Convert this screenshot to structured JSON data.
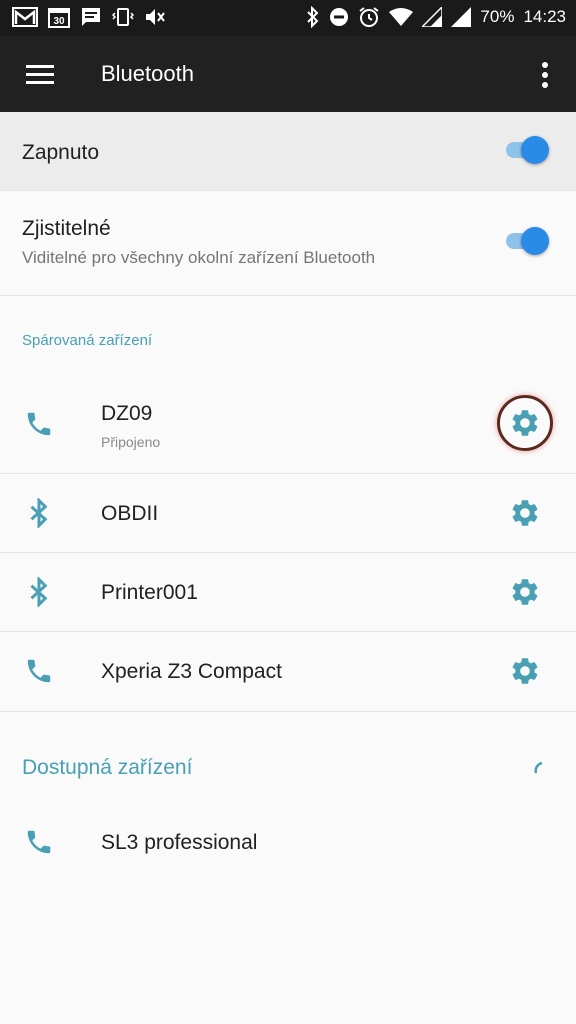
{
  "status_bar": {
    "battery": "70%",
    "time": "14:23",
    "left_icons": [
      "gmail-icon",
      "calendar-icon",
      "message-icon",
      "vibrate-icon",
      "mute-icon"
    ],
    "right_icons": [
      "bluetooth-icon",
      "dnd-icon",
      "alarm-icon",
      "wifi-icon",
      "signal-icon",
      "signal-icon",
      "battery-icon"
    ],
    "calendar_day": "30"
  },
  "appbar": {
    "title": "Bluetooth"
  },
  "settings": {
    "enabled": {
      "label": "Zapnuto",
      "on": true
    },
    "discoverable": {
      "label": "Zjistitelné",
      "sub": "Viditelné pro všechny okolní zařízení Bluetooth",
      "on": true
    }
  },
  "paired": {
    "header": "Spárovaná zařízení",
    "devices": [
      {
        "name": "DZ09",
        "status": "Připojeno",
        "icon": "phone-icon"
      },
      {
        "name": "OBDII",
        "status": "",
        "icon": "bluetooth-icon"
      },
      {
        "name": "Printer001",
        "status": "",
        "icon": "bluetooth-icon"
      },
      {
        "name": "Xperia Z3 Compact",
        "status": "",
        "icon": "phone-icon"
      }
    ]
  },
  "available": {
    "header": "Dostupná zařízení",
    "devices": [
      {
        "name": "SL3 professional",
        "icon": "phone-icon"
      }
    ]
  },
  "colors": {
    "accent": "#4a9fb5",
    "toggle_thumb": "#2a8be6",
    "toggle_track": "#8fc2ea",
    "appbar": "#212121"
  }
}
